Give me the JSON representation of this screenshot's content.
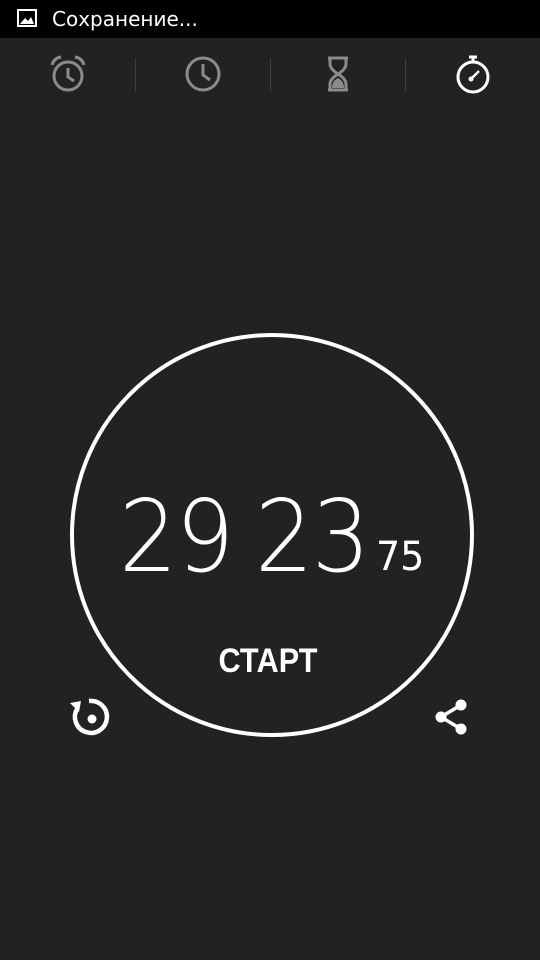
{
  "status_bar": {
    "notification_icon": "image-icon",
    "notification_text": "Сохранение..."
  },
  "tabs": [
    {
      "name": "alarm",
      "icon": "alarm-clock-icon",
      "active": false
    },
    {
      "name": "clock",
      "icon": "clock-icon",
      "active": false
    },
    {
      "name": "timer",
      "icon": "hourglass-icon",
      "active": false
    },
    {
      "name": "stopwatch",
      "icon": "stopwatch-icon",
      "active": true
    }
  ],
  "stopwatch": {
    "minutes": "29",
    "seconds": "23",
    "hundredths": "75",
    "start_label": "СТАРТ",
    "reset_icon": "reset-icon",
    "share_icon": "share-icon"
  },
  "colors": {
    "background": "#212224",
    "status_bar": "#000000",
    "foreground": "#ffffff",
    "inactive_icon": "#8a8b8d"
  }
}
